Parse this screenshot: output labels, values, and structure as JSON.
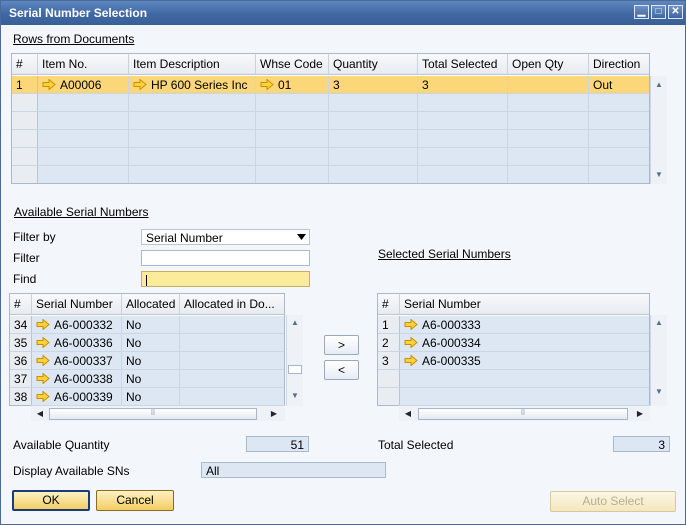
{
  "window": {
    "title": "Serial Number Selection",
    "min_glyph": "▁",
    "max_glyph": "□",
    "close_glyph": "✕"
  },
  "rows_from_documents": {
    "title": "Rows from Documents",
    "columns": [
      "#",
      "Item No.",
      "Item Description",
      "Whse Code",
      "Quantity",
      "Total Selected",
      "Open Qty",
      "Direction"
    ],
    "rows": [
      {
        "num": "1",
        "item_no": "A00006",
        "description": "HP 600 Series Inc",
        "whse": "01",
        "quantity": "3",
        "total_selected": "3",
        "open_qty": "",
        "direction": "Out"
      }
    ]
  },
  "available": {
    "title": "Available Serial Numbers",
    "filter_by_label": "Filter by",
    "filter_by_value": "Serial Number",
    "filter_label": "Filter",
    "filter_value": "",
    "find_label": "Find",
    "find_value": "",
    "columns": [
      "#",
      "Serial Number",
      "Allocated",
      "Allocated in Do..."
    ],
    "rows": [
      {
        "num": "34",
        "serial": "A6-000332",
        "allocated": "No",
        "alloc_doc": ""
      },
      {
        "num": "35",
        "serial": "A6-000336",
        "allocated": "No",
        "alloc_doc": ""
      },
      {
        "num": "36",
        "serial": "A6-000337",
        "allocated": "No",
        "alloc_doc": ""
      },
      {
        "num": "37",
        "serial": "A6-000338",
        "allocated": "No",
        "alloc_doc": ""
      },
      {
        "num": "38",
        "serial": "A6-000339",
        "allocated": "No",
        "alloc_doc": ""
      }
    ],
    "quantity_label": "Available Quantity",
    "quantity_value": "51",
    "display_label": "Display Available SNs",
    "display_value": "All"
  },
  "move": {
    "add_label": ">",
    "remove_label": "<"
  },
  "selected": {
    "title": "Selected Serial Numbers",
    "columns": [
      "#",
      "Serial Number"
    ],
    "rows": [
      {
        "num": "1",
        "serial": "A6-000333"
      },
      {
        "num": "2",
        "serial": "A6-000334"
      },
      {
        "num": "3",
        "serial": "A6-000335"
      }
    ],
    "total_label": "Total Selected",
    "total_value": "3"
  },
  "buttons": {
    "ok": "OK",
    "cancel": "Cancel",
    "auto_select": "Auto Select"
  },
  "scroll": {
    "up": "▲",
    "down": "▼",
    "left": "◀",
    "right": "▶",
    "grip": "⠿"
  },
  "colors": {
    "title_bar": "#3f68a3",
    "selected_row": "#fbd77a",
    "row_fill": "#dde7f4",
    "button": "#f3cd62",
    "link_arrow": "#f0b400"
  }
}
